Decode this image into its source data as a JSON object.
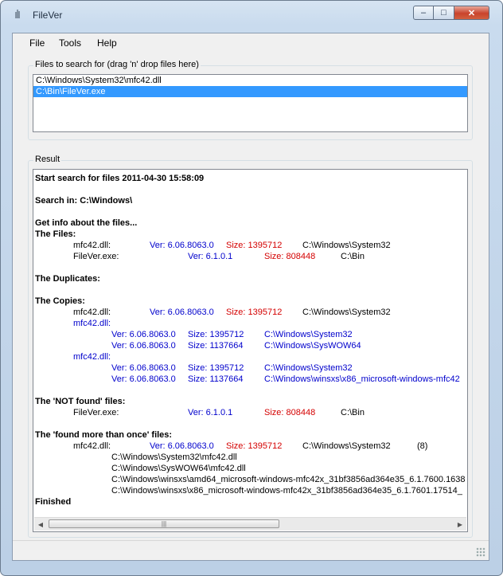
{
  "window": {
    "title": "FileVer",
    "minimize_label": "–",
    "maximize_label": "□",
    "close_label": "✕"
  },
  "menu": {
    "items": [
      "File",
      "Tools",
      "Help"
    ]
  },
  "files_group": {
    "label": "Files to search for (drag 'n' drop files here)",
    "files": [
      {
        "path": "C:\\Windows\\System32\\mfc42.dll",
        "selected": false
      },
      {
        "path": "C:\\Bin\\FileVer.exe",
        "selected": true
      }
    ]
  },
  "result_group": {
    "label": "Result",
    "lines": {
      "start": "Start search for files 2011-04-30 15:58:09",
      "search_in": "Search in: C:\\Windows\\",
      "get_info": "Get info about the files...",
      "the_files": "The Files:",
      "f1_name": "mfc42.dll:",
      "f1_ver": "Ver: 6.06.8063.0",
      "f1_size": "Size: 1395712",
      "f1_path": "C:\\Windows\\System32",
      "f2_name": "FileVer.exe:",
      "f2_ver": "Ver: 6.1.0.1",
      "f2_size": "Size: 808448",
      "f2_path": "C:\\Bin",
      "duplicates": "The Duplicates:",
      "copies": "The Copies:",
      "c1_name": "mfc42.dll:",
      "c1_ver": "Ver: 6.06.8063.0",
      "c1_size": "Size: 1395712",
      "c1_path": "C:\\Windows\\System32",
      "c2_name": "mfc42.dll:",
      "c2a_ver": "Ver: 6.06.8063.0",
      "c2a_size": "Size: 1395712",
      "c2a_path": "C:\\Windows\\System32",
      "c2b_ver": "Ver: 6.06.8063.0",
      "c2b_size": "Size: 1137664",
      "c2b_path": "C:\\Windows\\SysWOW64",
      "c3_name": "mfc42.dll:",
      "c3a_ver": "Ver: 6.06.8063.0",
      "c3a_size": "Size: 1395712",
      "c3a_path": "C:\\Windows\\System32",
      "c3b_ver": "Ver: 6.06.8063.0",
      "c3b_size": "Size: 1137664",
      "c3b_path": "C:\\Windows\\winsxs\\x86_microsoft-windows-mfc42",
      "not_found": "The 'NOT found' files:",
      "n1_name": "FileVer.exe:",
      "n1_ver": "Ver: 6.1.0.1",
      "n1_size": "Size: 808448",
      "n1_path": "C:\\Bin",
      "more_once": "The 'found more than once' files:",
      "m1_name": "mfc42.dll:",
      "m1_ver": "Ver: 6.06.8063.0",
      "m1_size": "Size: 1395712",
      "m1_path": "C:\\Windows\\System32",
      "m1_count": "(8)",
      "m_p1": "C:\\Windows\\System32\\mfc42.dll",
      "m_p2": "C:\\Windows\\SysWOW64\\mfc42.dll",
      "m_p3": "C:\\Windows\\winsxs\\amd64_microsoft-windows-mfc42x_31bf3856ad364e35_6.1.7600.1638",
      "m_p4": "C:\\Windows\\winsxs\\x86_microsoft-windows-mfc42x_31bf3856ad364e35_6.1.7601.17514_",
      "finished": "Finished"
    }
  },
  "scrollbar": {
    "left_arrow": "◀",
    "right_arrow": "▶",
    "thumb_grip": "|||"
  },
  "icons": [
    "app-icon",
    "minimize-icon",
    "maximize-icon",
    "close-icon",
    "size-grip-icon"
  ],
  "colors": {
    "selection": "#3399ff",
    "version_text": "#0000cc",
    "size_text": "#d40000"
  }
}
